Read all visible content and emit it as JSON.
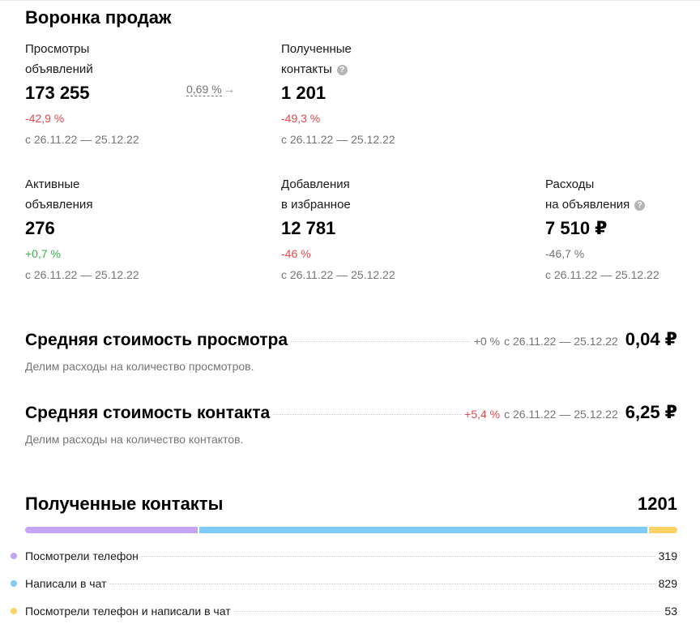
{
  "funnel": {
    "title": "Воронка продаж",
    "conversion": {
      "value": "0,69 %",
      "arrow": "→"
    },
    "period": "с 26.11.22 — 25.12.22",
    "metrics": {
      "views": {
        "label_line1": "Просмотры",
        "label_line2": "объявлений",
        "value": "173 255",
        "change": "-42,9 %"
      },
      "contacts": {
        "label_line1": "Полученные",
        "label_line2": "контакты",
        "value": "1 201",
        "change": "-49,3 %"
      },
      "active": {
        "label_line1": "Активные",
        "label_line2": "объявления",
        "value": "276",
        "change": "+0,7 %"
      },
      "favorites": {
        "label_line1": "Добавления",
        "label_line2": "в избранное",
        "value": "12 781",
        "change": "-46 %"
      },
      "expenses": {
        "label_line1": "Расходы",
        "label_line2": "на объявления",
        "value": "7 510 ₽",
        "change": "-46,7 %"
      }
    },
    "info_icon": "?"
  },
  "cost_view": {
    "title": "Средняя стоимость просмотра",
    "change": "+0 %",
    "period": "с 26.11.22 — 25.12.22",
    "value": "0,04 ₽",
    "description": "Делим расходы на количество просмотров."
  },
  "cost_contact": {
    "title": "Средняя стоимость контакта",
    "change": "+5,4 %",
    "period": "с 26.11.22 — 25.12.22",
    "value": "6,25 ₽",
    "description": "Делим расходы на количество контактов."
  },
  "received": {
    "title": "Полученные контакты",
    "total": "1201",
    "items": [
      {
        "label": "Посмотрели телефон",
        "count": "319",
        "color": "#c5a3f5"
      },
      {
        "label": "Написали в чат",
        "count": "829",
        "color": "#7fcbf9"
      },
      {
        "label": "Посмотрели телефон и написали в чат",
        "count": "53",
        "color": "#fbd364"
      }
    ]
  }
}
